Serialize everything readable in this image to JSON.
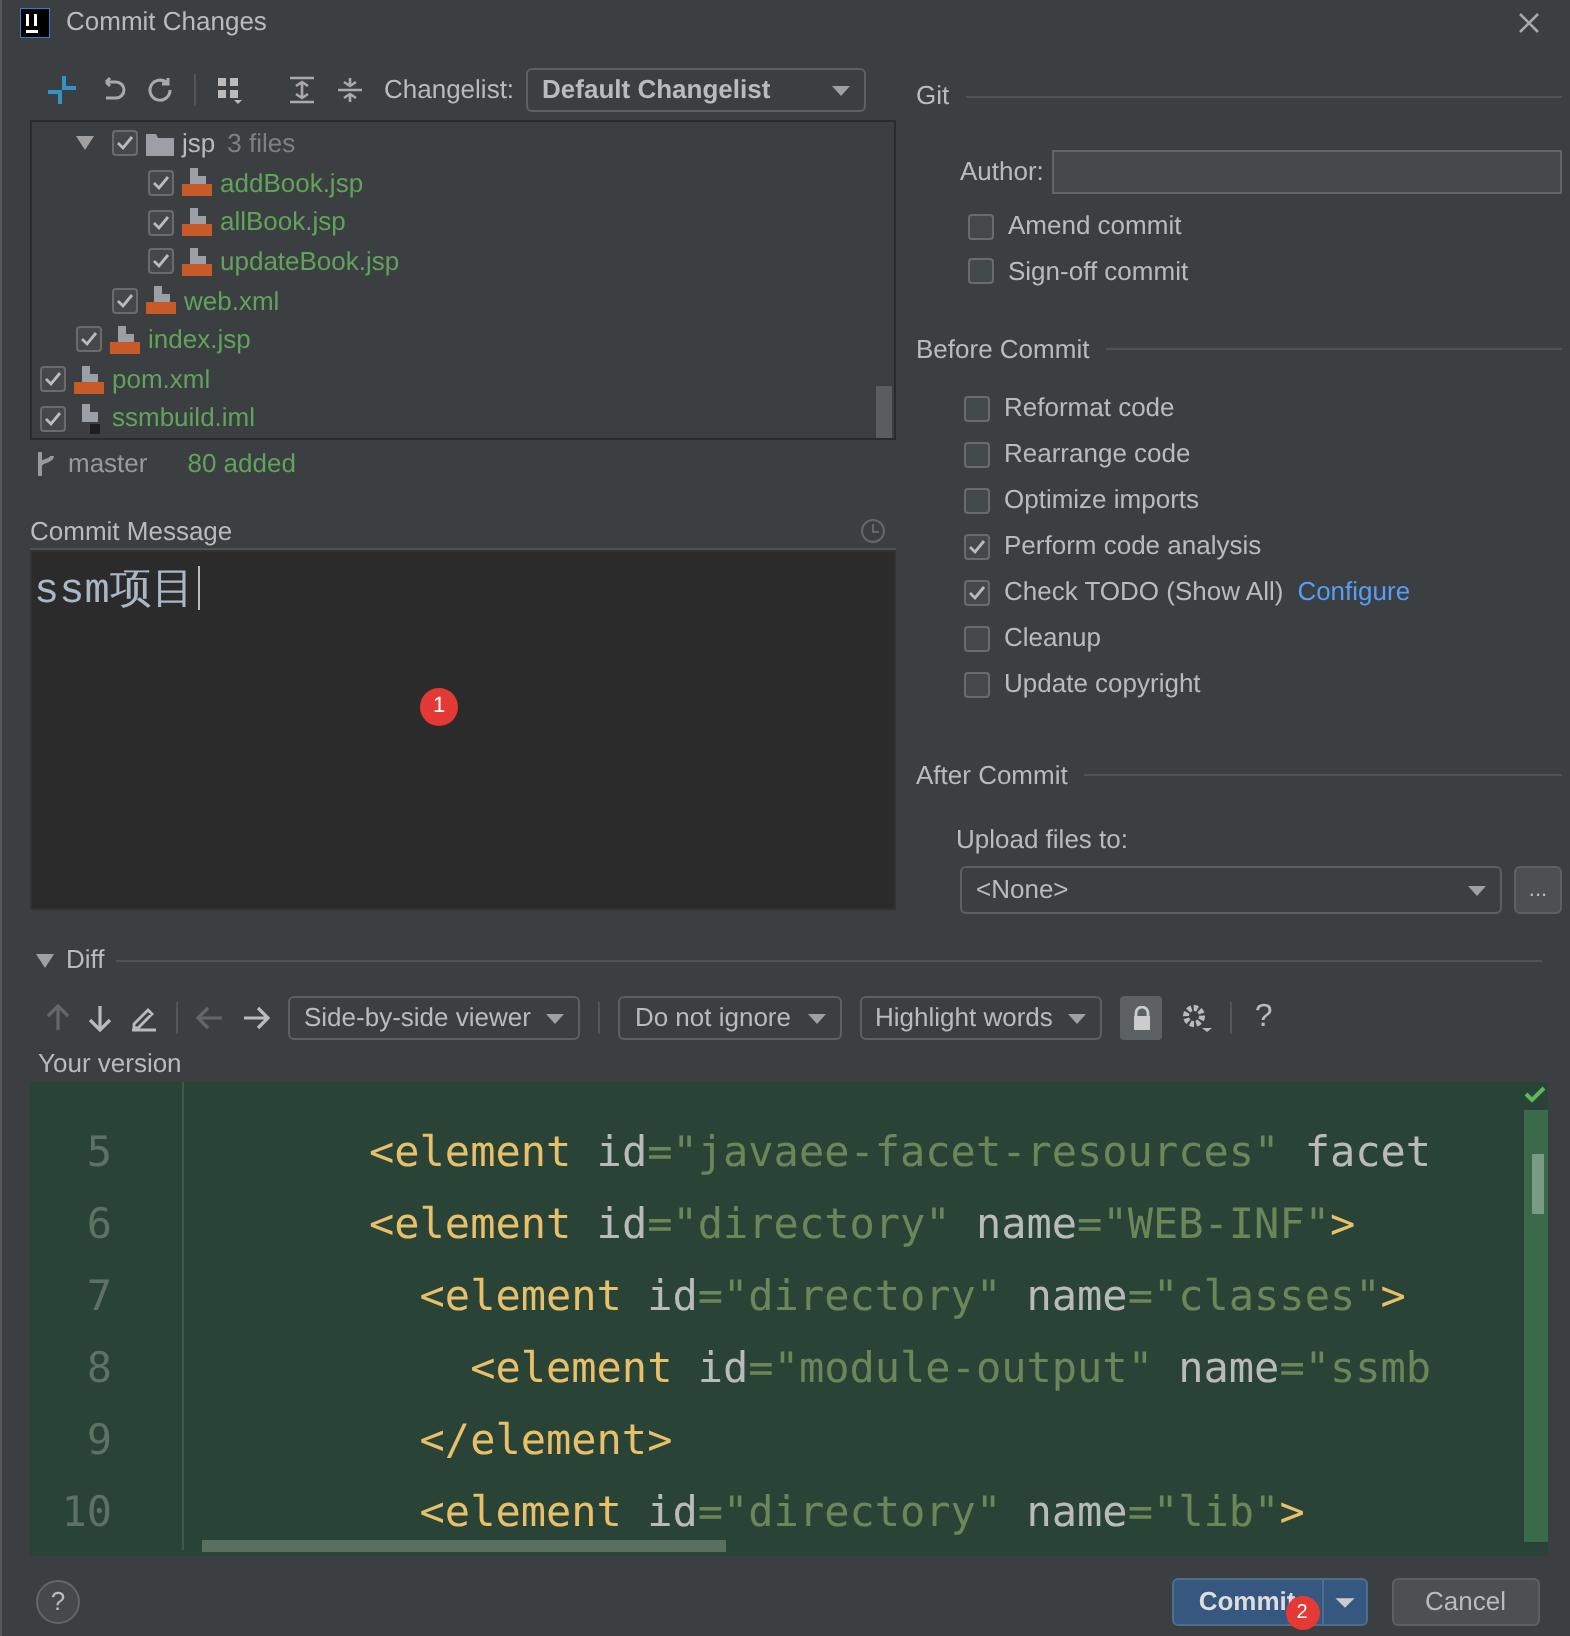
{
  "window": {
    "title": "Commit Changes"
  },
  "toolbar": {
    "changelist_label": "Changelist:",
    "changelist_value": "Default Changelist"
  },
  "tree": {
    "items": [
      {
        "kind": "hidden",
        "children": [
          {
            "kind": "hidden",
            "children": [
              {
                "kind": "folder",
                "name": "jsp",
                "count": "3 files",
                "expanded": true,
                "checked": true,
                "children": [
                  {
                    "kind": "jsp",
                    "name": "addBook.jsp",
                    "checked": true
                  },
                  {
                    "kind": "jsp",
                    "name": "allBook.jsp",
                    "checked": true
                  },
                  {
                    "kind": "jsp",
                    "name": "updateBook.jsp",
                    "checked": true
                  }
                ]
              },
              {
                "kind": "xml",
                "name": "web.xml",
                "checked": true
              }
            ]
          },
          {
            "kind": "jsp",
            "name": "index.jsp",
            "checked": true
          }
        ]
      },
      {
        "kind": "xml",
        "name": "pom.xml",
        "checked": true
      },
      {
        "kind": "iml",
        "name": "ssmbuild.iml",
        "checked": true
      }
    ]
  },
  "status": {
    "branch": "master",
    "summary": "80 added"
  },
  "commit_message": {
    "label": "Commit Message",
    "value": "ssm项目",
    "marker": "1"
  },
  "git": {
    "title": "Git",
    "author_label": "Author:",
    "options": [
      {
        "label": "Amend commit",
        "checked": false
      },
      {
        "label": "Sign-off commit",
        "checked": false
      }
    ]
  },
  "before_commit": {
    "title": "Before Commit",
    "options": [
      {
        "label": "Reformat code",
        "checked": false
      },
      {
        "label": "Rearrange code",
        "checked": false
      },
      {
        "label": "Optimize imports",
        "checked": false
      },
      {
        "label": "Perform code analysis",
        "checked": true
      },
      {
        "label": "Check TODO (Show All)",
        "checked": true,
        "link": "Configure"
      },
      {
        "label": "Cleanup",
        "checked": false
      },
      {
        "label": "Update copyright",
        "checked": false
      }
    ]
  },
  "after_commit": {
    "title": "After Commit",
    "upload_label": "Upload files to:",
    "upload_value": "<None>",
    "browse": "..."
  },
  "diff": {
    "title": "Diff",
    "expanded": true,
    "viewer": "Side-by-side viewer",
    "ignore": "Do not ignore",
    "highlight": "Highlight words",
    "help": "?",
    "side_label": "Your version",
    "lines": [
      {
        "number": "5",
        "tokens": [
          {
            "kind": "tag",
            "text": "       <element "
          },
          {
            "kind": "attr",
            "text": "id"
          },
          {
            "kind": "value",
            "text": "=\"javaee-facet-resources\" "
          },
          {
            "kind": "attr",
            "text": "facet"
          }
        ]
      },
      {
        "number": "6",
        "tokens": [
          {
            "kind": "tag",
            "text": "       <element "
          },
          {
            "kind": "attr",
            "text": "id"
          },
          {
            "kind": "value",
            "text": "=\"directory\" "
          },
          {
            "kind": "attr",
            "text": "name"
          },
          {
            "kind": "value",
            "text": "=\"WEB-INF\""
          },
          {
            "kind": "tag",
            "text": ">"
          }
        ]
      },
      {
        "number": "7",
        "tokens": [
          {
            "kind": "tag",
            "text": "         <element "
          },
          {
            "kind": "attr",
            "text": "id"
          },
          {
            "kind": "value",
            "text": "=\"directory\" "
          },
          {
            "kind": "attr",
            "text": "name"
          },
          {
            "kind": "value",
            "text": "=\"classes\""
          },
          {
            "kind": "tag",
            "text": ">"
          }
        ]
      },
      {
        "number": "8",
        "tokens": [
          {
            "kind": "tag",
            "text": "           <element "
          },
          {
            "kind": "attr",
            "text": "id"
          },
          {
            "kind": "value",
            "text": "=\"module-output\" "
          },
          {
            "kind": "attr",
            "text": "name"
          },
          {
            "kind": "value",
            "text": "=\"ssmb"
          }
        ]
      },
      {
        "number": "9",
        "tokens": [
          {
            "kind": "tag",
            "text": "         </element>"
          }
        ]
      },
      {
        "number": "10",
        "tokens": [
          {
            "kind": "tag",
            "text": "         <element "
          },
          {
            "kind": "attr",
            "text": "id"
          },
          {
            "kind": "value",
            "text": "=\"directory\" "
          },
          {
            "kind": "attr",
            "text": "name"
          },
          {
            "kind": "value",
            "text": "=\"lib\""
          },
          {
            "kind": "tag",
            "text": ">"
          }
        ]
      }
    ]
  },
  "footer": {
    "help": "?",
    "commit": "Commit",
    "commit_marker": "2",
    "cancel": "Cancel"
  }
}
